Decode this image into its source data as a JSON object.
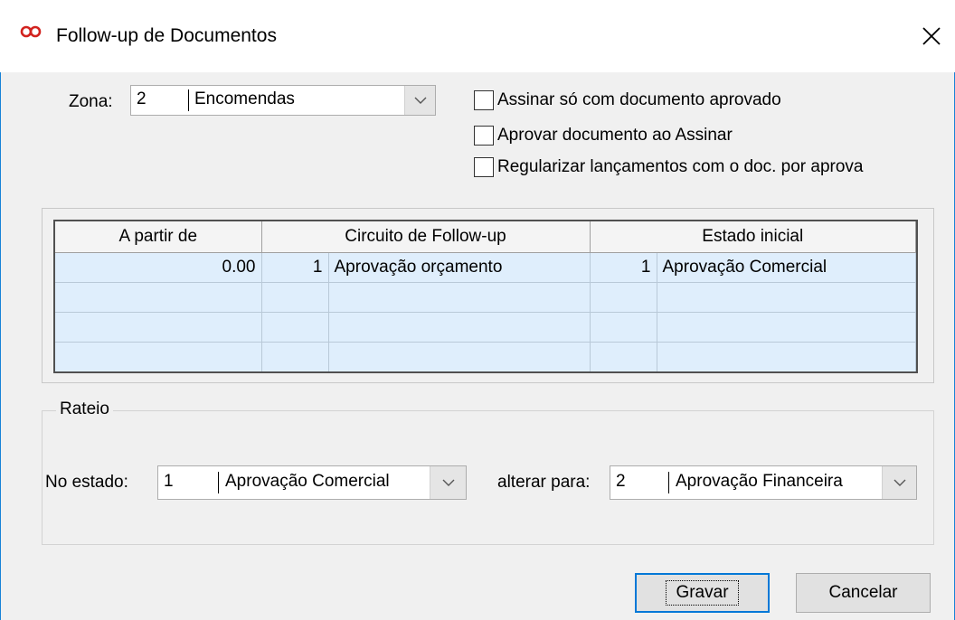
{
  "window": {
    "title": "Follow-up de Documentos",
    "app_icon": "infinity-icon",
    "close_icon": "close-icon",
    "accent_color": "#1883d7"
  },
  "zona": {
    "label": "Zona:",
    "code": "2",
    "value": "Encomendas"
  },
  "options": [
    {
      "label": "Assinar só com documento aprovado",
      "checked": false
    },
    {
      "label": "Aprovar documento ao Assinar",
      "checked": false
    },
    {
      "label": "Regularizar lançamentos com o doc. por aprova",
      "checked": false
    }
  ],
  "grid": {
    "columns": [
      "A partir de",
      "Circuito de Follow-up",
      "Estado inicial"
    ],
    "rows": [
      {
        "from": "0.00",
        "circuit_code": "1",
        "circuit": "Aprovação orçamento",
        "state_code": "1",
        "state": "Aprovação Comercial"
      }
    ]
  },
  "rateio": {
    "title": "Rateio",
    "from_label": "No estado:",
    "from_code": "1",
    "from_value": "Aprovação Comercial",
    "to_label": "alterar para:",
    "to_code": "2",
    "to_value": "Aprovação Financeira"
  },
  "buttons": {
    "save": "Gravar",
    "cancel": "Cancelar"
  }
}
